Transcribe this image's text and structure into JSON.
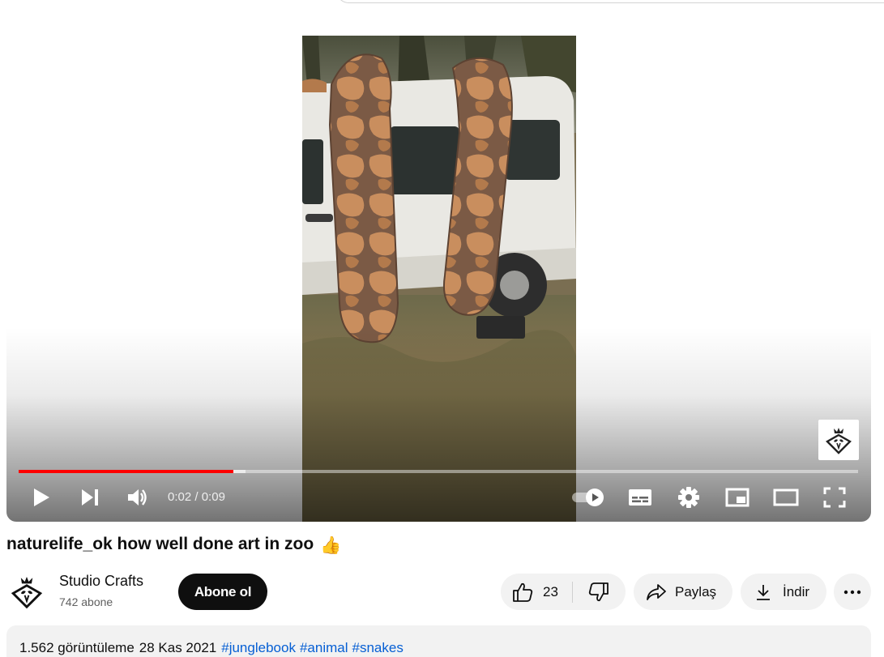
{
  "player": {
    "time_current": "0:02",
    "time_separator": " / ",
    "time_total": "0:09",
    "progress_fraction": 0.256,
    "progress_color": "#ff0000"
  },
  "video": {
    "title": "naturelife_ok how well done art in zoo",
    "title_emoji": "👍"
  },
  "channel": {
    "name": "Studio Crafts",
    "subscribers": "742 abone",
    "subscribe_label": "Abone ol"
  },
  "actions": {
    "like_count": "23",
    "share_label": "Paylaş",
    "download_label": "İndir"
  },
  "description": {
    "views": "1.562 görüntüleme",
    "date": "28 Kas 2021",
    "hashtags": [
      "#junglebook",
      "#animal",
      "#snakes"
    ]
  },
  "icons": {
    "play": "play-icon",
    "next": "next-icon",
    "volume": "volume-icon",
    "autoplay": "autoplay-toggle-icon",
    "subtitles": "subtitles-icon",
    "settings": "gear-icon",
    "miniplayer": "miniplayer-icon",
    "theater": "theater-mode-icon",
    "fullscreen": "fullscreen-icon",
    "like": "thumbs-up-icon",
    "dislike": "thumbs-down-icon",
    "share": "share-arrow-icon",
    "download": "download-icon",
    "more": "more-horizontal-icon"
  }
}
